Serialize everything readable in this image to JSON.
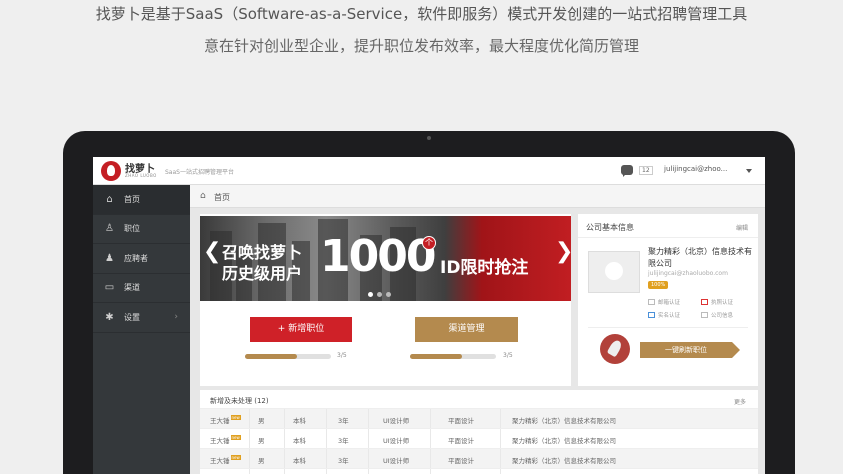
{
  "headline": {
    "line1": "找萝卜是基于SaaS（Software-as-a-Service，软件即服务）模式开发创建的一站式招聘管理工具",
    "line2": "意在针对创业型企业，提升职位发布效率，最大程度优化简历管理"
  },
  "app": {
    "logo_text": "找萝卜",
    "logo_sub": "ZHAO LUOBO",
    "tagline": "SaaS一站式招聘管理平台",
    "msg_count": "12",
    "user_email": "julijingcai@zhoo..."
  },
  "sidebar": {
    "items": [
      {
        "label": "首页",
        "icon": "home-icon"
      },
      {
        "label": "职位",
        "icon": "person-icon"
      },
      {
        "label": "应聘者",
        "icon": "user-icon"
      },
      {
        "label": "渠道",
        "icon": "inbox-icon"
      },
      {
        "label": "设置",
        "icon": "gear-icon"
      }
    ]
  },
  "breadcrumb": {
    "label": "首页"
  },
  "banner": {
    "line1": "召唤找萝卜",
    "line2": "历史级用户",
    "number": "1000",
    "badge": "个",
    "line3": "ID限时抢注",
    "prev": "❮",
    "next": "❯"
  },
  "actions": {
    "add_job": "+ 新增职位",
    "channel": "渠道管理",
    "progress1_label": "3/5",
    "progress2_label": "3/5",
    "progress1": 0.6,
    "progress2": 0.6
  },
  "company": {
    "title": "公司基本信息",
    "edit": "编辑",
    "name": "聚力精彩（北京）信息技术有限公司",
    "email": "julijingcai@zhaoluobo.com",
    "score": "100%",
    "verify": [
      {
        "label": "邮箱认证"
      },
      {
        "label": "执照认证"
      },
      {
        "label": "实名认证"
      },
      {
        "label": "公司信息"
      }
    ],
    "refresh": "一键刷新职位"
  },
  "table": {
    "title": "新增及未处理",
    "count": "(12)",
    "more": "更多",
    "new_tag": "new",
    "rows": [
      [
        "王大锤",
        "男",
        "本科",
        "3年",
        "UI设计师",
        "平面设计",
        "聚力精彩（北京）信息技术有限公司"
      ],
      [
        "王大锤",
        "男",
        "本科",
        "3年",
        "UI设计师",
        "平面设计",
        "聚力精彩（北京）信息技术有限公司"
      ],
      [
        "王大锤",
        "男",
        "本科",
        "3年",
        "UI设计师",
        "平面设计",
        "聚力精彩（北京）信息技术有限公司"
      ],
      [
        "王大锤",
        "男",
        "本科",
        "3年",
        "UI设计师",
        "平面设计",
        "聚力精彩（北京）信息技术有限公司"
      ]
    ]
  }
}
